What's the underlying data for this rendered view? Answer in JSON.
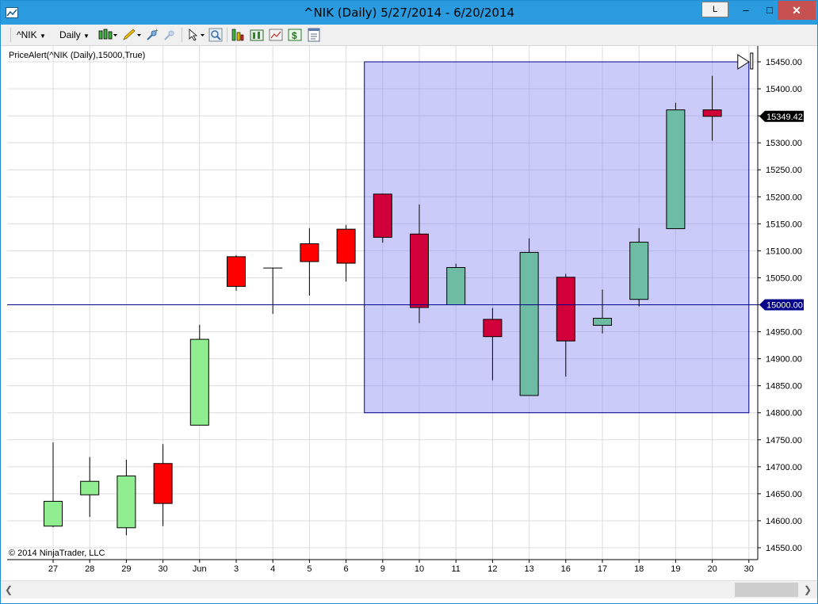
{
  "window": {
    "title": "^NIK (Daily)  5/27/2014 - 6/20/2014",
    "buttons": {
      "layout": "L",
      "minimize": "–",
      "maximize": "□",
      "close": "✕"
    }
  },
  "toolbar": {
    "instrument": "^NIK",
    "period": "Daily",
    "icons": [
      "bar-type-icon",
      "drawing-pencil-icon",
      "zoom-in-icon",
      "zoom-out-icon",
      "cursor-pointer-icon",
      "magnify-data-box-icon",
      "strategies-icon",
      "indicators-icon",
      "chart-trader-icon",
      "dollar-icon",
      "properties-icon"
    ]
  },
  "chart_data": {
    "type": "candlestick",
    "indicator_label": "PriceAlert(^NIK (Daily),15000,True)",
    "copyright": "© 2014 NinjaTrader, LLC",
    "x_labels": [
      "27",
      "28",
      "29",
      "30",
      "Jun",
      "3",
      "4",
      "5",
      "6",
      "9",
      "10",
      "11",
      "12",
      "13",
      "16",
      "17",
      "18",
      "19",
      "20",
      "30"
    ],
    "y_ticks": [
      "14550.00",
      "14600.00",
      "14650.00",
      "14700.00",
      "14750.00",
      "14800.00",
      "14850.00",
      "14900.00",
      "14950.00",
      "15000.00",
      "15050.00",
      "15100.00",
      "15150.00",
      "15200.00",
      "15250.00",
      "15300.00",
      "15350.00",
      "15400.00",
      "15450.00"
    ],
    "ylim": [
      14530,
      15470
    ],
    "grid": true,
    "last_price_label": "15349.42",
    "alert_price_label": "15000.00",
    "alert_price": 15000,
    "alert_line_color": "#00008b",
    "highlight_region": {
      "from": "9",
      "to": "30",
      "low": 14800,
      "high": 15450,
      "color": "#8c8cf5"
    },
    "colors": {
      "up": "#90ee90",
      "down": "#ff0000",
      "up_in_region": "#6ebca4",
      "down_in_region": "#d1003a"
    },
    "candles": [
      {
        "date": "27",
        "open": 14590,
        "high": 14745,
        "low": 14588,
        "close": 14636
      },
      {
        "date": "28",
        "open": 14648,
        "high": 14718,
        "low": 14607,
        "close": 14673
      },
      {
        "date": "29",
        "open": 14587,
        "high": 14713,
        "low": 14573,
        "close": 14683
      },
      {
        "date": "30",
        "open": 14706,
        "high": 14742,
        "low": 14590,
        "close": 14632
      },
      {
        "date": "Jun",
        "open": 14777,
        "high": 14963,
        "low": 14777,
        "close": 14936
      },
      {
        "date": "3",
        "open": 15089,
        "high": 15092,
        "low": 15026,
        "close": 15034
      },
      {
        "date": "4",
        "open": 15068,
        "high": 15068,
        "low": 14983,
        "close": 15068
      },
      {
        "date": "5",
        "open": 15113,
        "high": 15142,
        "low": 15017,
        "close": 15080
      },
      {
        "date": "6",
        "open": 15140,
        "high": 15148,
        "low": 15043,
        "close": 15077
      },
      {
        "date": "9",
        "open": 15205,
        "high": 15206,
        "low": 15115,
        "close": 15125
      },
      {
        "date": "10",
        "open": 15131,
        "high": 15186,
        "low": 14966,
        "close": 14995
      },
      {
        "date": "11",
        "open": 15000,
        "high": 15076,
        "low": 15000,
        "close": 15069
      },
      {
        "date": "12",
        "open": 14973,
        "high": 14994,
        "low": 14860,
        "close": 14941
      },
      {
        "date": "13",
        "open": 14832,
        "high": 15123,
        "low": 14832,
        "close": 15097
      },
      {
        "date": "16",
        "open": 15051,
        "high": 15057,
        "low": 14867,
        "close": 14933
      },
      {
        "date": "17",
        "open": 14962,
        "high": 15028,
        "low": 14947,
        "close": 14975
      },
      {
        "date": "18",
        "open": 15010,
        "high": 15142,
        "low": 14997,
        "close": 15116
      },
      {
        "date": "19",
        "open": 15141,
        "high": 15374,
        "low": 15141,
        "close": 15361
      },
      {
        "date": "20",
        "open": 15361,
        "high": 15424,
        "low": 15304,
        "close": 15349
      }
    ]
  }
}
